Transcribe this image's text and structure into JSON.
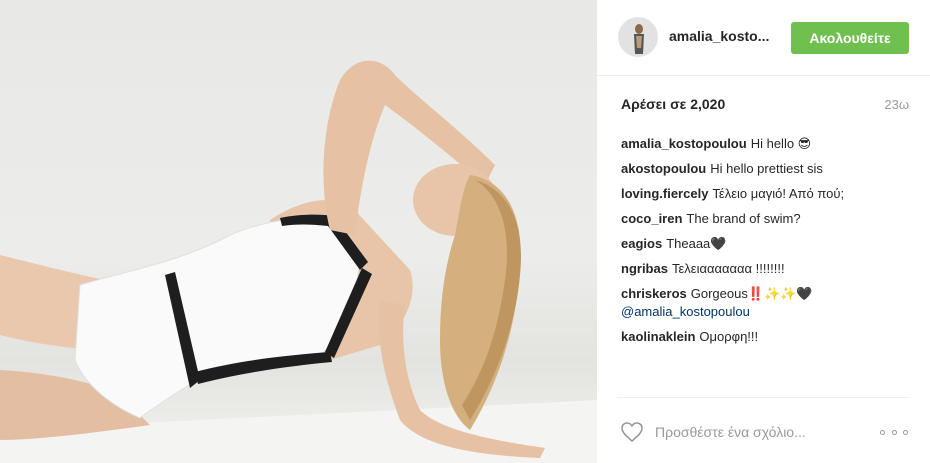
{
  "post": {
    "photo_icon": "post-photo",
    "author": {
      "username": "amalia_kosto...",
      "avatar_icon": "user-avatar"
    },
    "follow_label": "Ακολουθείτε",
    "likes_text": "Αρέσει σε 2,020",
    "time_ago": "23ω"
  },
  "comments": [
    {
      "user": "amalia_kostopoulou",
      "text": "Hi hello 😎",
      "mention": ""
    },
    {
      "user": "akostopoulou",
      "text": "Hi hello prettiest sis",
      "mention": ""
    },
    {
      "user": "loving.fiercely",
      "text": "Τέλειο μαγιό! Από πού;",
      "mention": ""
    },
    {
      "user": "coco_iren",
      "text": "The brand of swim?",
      "mention": ""
    },
    {
      "user": "eagios",
      "text": "Theaaa🖤",
      "mention": ""
    },
    {
      "user": "ngribas",
      "text": "Τελειααααααα !!!!!!!!",
      "mention": ""
    },
    {
      "user": "chriskeros",
      "text": "Gorgeous‼️✨✨🖤",
      "mention": "@amalia_kostopoulou"
    },
    {
      "user": "kaolinaklein",
      "text": "Ομορφη!!!",
      "mention": ""
    }
  ],
  "footer": {
    "like_icon": "heart-icon",
    "comment_placeholder": "Προσθέστε ένα σχόλιο...",
    "more_icon": "more-options-icon"
  },
  "colors": {
    "follow_button": "#70c050",
    "mention": "#003569",
    "muted_text": "#999999"
  }
}
